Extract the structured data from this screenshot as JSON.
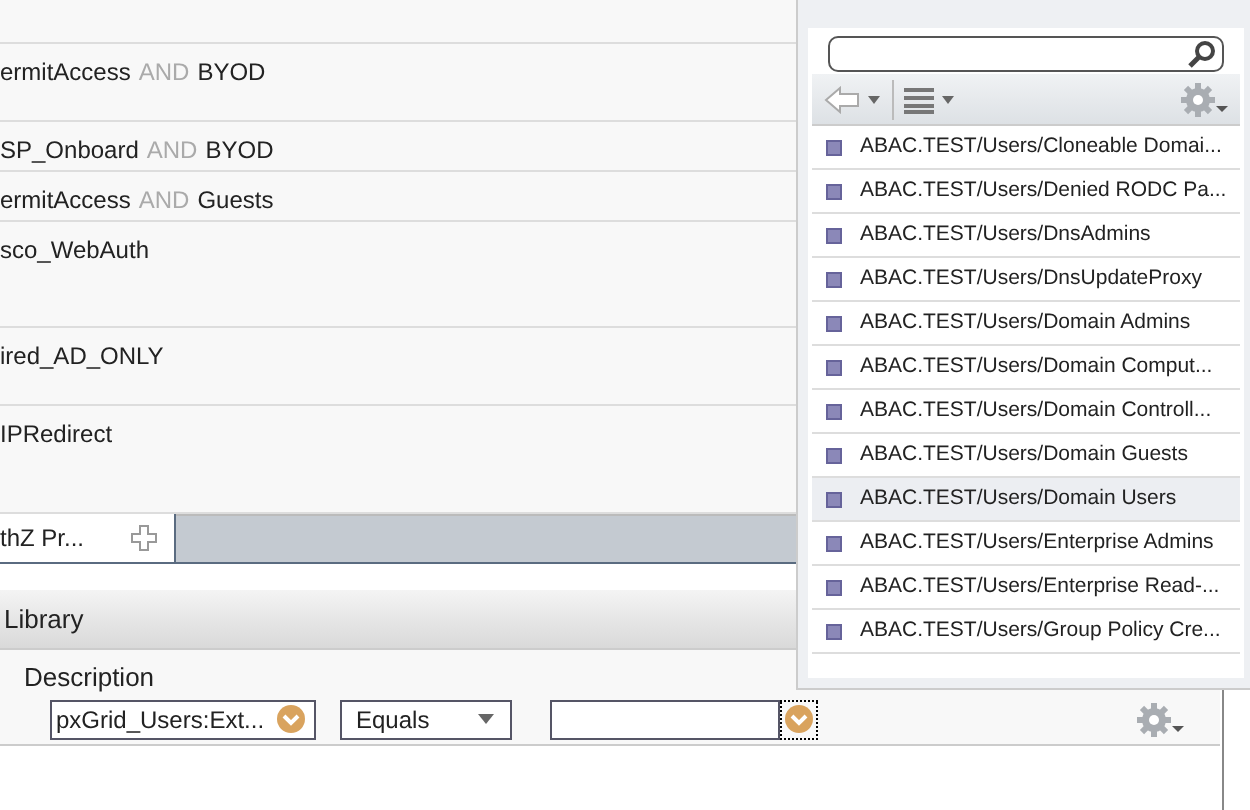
{
  "rules": [
    {
      "parts": [
        {
          "kind": "name",
          "text": "ermitAccess"
        },
        {
          "kind": "operator",
          "text": "AND"
        },
        {
          "kind": "name",
          "text": "BYOD"
        }
      ]
    },
    {
      "parts": [
        {
          "kind": "name",
          "text": "SP_Onboard"
        },
        {
          "kind": "operator",
          "text": "AND"
        },
        {
          "kind": "name",
          "text": "BYOD"
        }
      ]
    },
    {
      "parts": [
        {
          "kind": "name",
          "text": "ermitAccess"
        },
        {
          "kind": "operator",
          "text": "AND"
        },
        {
          "kind": "name",
          "text": "Guests"
        }
      ]
    },
    {
      "parts": [
        {
          "kind": "name",
          "text": "sco_WebAuth"
        }
      ]
    },
    {
      "parts": [
        {
          "kind": "name",
          "text": "ired_AD_ONLY"
        }
      ]
    },
    {
      "parts": [
        {
          "kind": "name",
          "text": "IPRedirect"
        }
      ]
    }
  ],
  "tabs": [
    {
      "label": "thZ Pr...",
      "selected": true
    }
  ],
  "library": {
    "title": "Library"
  },
  "condition": {
    "label": "Description",
    "attribute": "pxGrid_Users:Ext...",
    "operator": "Equals"
  },
  "picker": {
    "items": [
      {
        "label": "ABAC.TEST/Users/Cloneable Domai...",
        "selected": false
      },
      {
        "label": "ABAC.TEST/Users/Denied RODC Pa...",
        "selected": false
      },
      {
        "label": "ABAC.TEST/Users/DnsAdmins",
        "selected": false
      },
      {
        "label": "ABAC.TEST/Users/DnsUpdateProxy",
        "selected": false
      },
      {
        "label": "ABAC.TEST/Users/Domain Admins",
        "selected": false
      },
      {
        "label": "ABAC.TEST/Users/Domain Comput...",
        "selected": false
      },
      {
        "label": "ABAC.TEST/Users/Domain Controll...",
        "selected": false
      },
      {
        "label": "ABAC.TEST/Users/Domain Guests",
        "selected": false
      },
      {
        "label": "ABAC.TEST/Users/Domain Users",
        "selected": true
      },
      {
        "label": "ABAC.TEST/Users/Enterprise Admins",
        "selected": false
      },
      {
        "label": "ABAC.TEST/Users/Enterprise Read-...",
        "selected": false
      },
      {
        "label": "ABAC.TEST/Users/Group Policy Cre...",
        "selected": false
      }
    ]
  }
}
